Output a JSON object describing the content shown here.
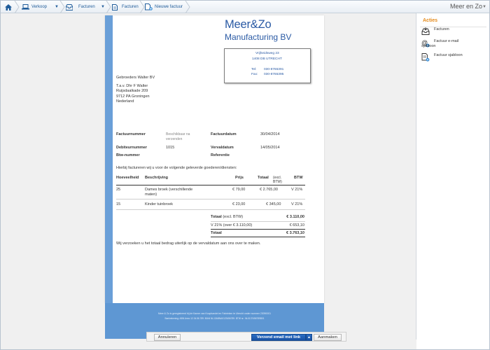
{
  "breadcrumb": {
    "home_icon": "home-icon",
    "items": [
      {
        "label": "Verkoop",
        "icon": "laptop-icon"
      },
      {
        "label": "Facturen",
        "icon": "inbox-icon"
      },
      {
        "label": "Facturen",
        "icon": "document-icon"
      },
      {
        "label": "Nieuwe factuur",
        "icon": "document-add-icon"
      }
    ],
    "company": "Meer en Zo"
  },
  "actions_panel": {
    "title": "Acties",
    "items": [
      {
        "label": "Facturen",
        "icon": "inbox-icon"
      },
      {
        "label": "Factuur e-mail",
        "sub": "sjabloon",
        "icon": "email-gear-icon"
      },
      {
        "label": "Factuur sjabloon",
        "icon": "document-gear-icon"
      }
    ]
  },
  "invoice": {
    "logo_line1": "Meer&Zo",
    "logo_line2": "Manufacturing BV",
    "sender": {
      "street": "Vrijheidsweg 23",
      "city": "1408 DB  UTRECHT",
      "tel_label": "Tel:",
      "tel": "030-8765391",
      "fax_label": "Fax:",
      "fax": "030-8765395"
    },
    "customer": [
      "Gebroeders Walter BV",
      "T.a.v. Dhr F Walter",
      "Ruijsdaalkade 209",
      "9712 PA Groningen",
      "Nederland"
    ],
    "meta": {
      "invoice_number_label": "Factuurnummer",
      "invoice_number_value_1": "Beschikbaar na",
      "invoice_number_value_2": "verzenden",
      "invoice_date_label": "Factuurdatum",
      "invoice_date": "30/04/2014",
      "debtor_number_label": "Debiteurnummer",
      "debtor_number": "1015",
      "due_date_label": "Vervaldatum",
      "due_date": "14/05/2014",
      "vat_number_label": "Btw-nummer",
      "reference_label": "Referentie"
    },
    "intro": "Hierbij factureren wij u voor de volgende geleverde goederen/diensten:",
    "columns": {
      "qty": "Hoeveelheid",
      "desc": "Beschrijving",
      "price": "Prijs",
      "total": "Totaal",
      "total_sub1": "(excl.",
      "total_sub2": "BTW)",
      "vat": "BTW"
    },
    "lines": [
      {
        "qty": "25",
        "desc1": "Dames broek (verschillende",
        "desc2": "maten)",
        "price": "€ 79,00",
        "total": "€ 2.765,00",
        "vat": "V 21%"
      },
      {
        "qty": "15",
        "desc1": "Kinder tuinbroek",
        "desc2": "",
        "price": "€ 23,00",
        "total": "€ 345,00",
        "vat": "V 21%"
      }
    ],
    "totals": {
      "subtotal_label_bold": "Totaal",
      "subtotal_label_rest": " (excl. BTW)",
      "subtotal": "€ 3.110,00",
      "vat_label": "V 21% (over € 3.110,00)",
      "vat": "€ 653,10",
      "total_label": "Totaal",
      "total": "€ 3.763,10"
    },
    "closing": "Wij verzoeken u het totaal bedrag uiterlijk op de vervaldatum aan ons over te maken.",
    "footer_line1": "Meer & Zo is geregistreerd bij de Kamer van Koophandel en Fabrieken te Utrecht onder nummer 23090001",
    "footer_line2": "Bankrekening: ABN Amro 12.34.56.789. IBAN NL13ABNA0123456789. BTW nr.: NL0137456789B01"
  },
  "buttons": {
    "cancel": "Annuleren",
    "send": "Verzend email met link",
    "adjust": "Aanmaken"
  },
  "colors": {
    "accent_blue": "#2a5aa4",
    "strip_blue": "#6a9fd8",
    "footer_blue": "#5e97d3",
    "actions_orange": "#e48a1a",
    "primary_button": "#1f5fb4"
  }
}
